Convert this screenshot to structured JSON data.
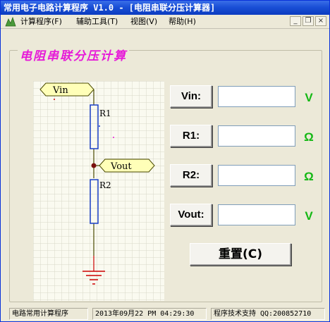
{
  "window": {
    "title": "常用电子电路计算程序  V1.0 - [电阻串联分压计算器]"
  },
  "menu": {
    "icon": "app-icon",
    "items": [
      "计算程序(F)",
      "辅助工具(T)",
      "视图(V)",
      "帮助(H)"
    ],
    "mdi_buttons": [
      "_",
      "❐",
      "×"
    ]
  },
  "calculator": {
    "title": "电阻串联分压计算",
    "schematic": {
      "vin_label": "Vin",
      "vout_label": "Vout",
      "r1_label": "R1",
      "r2_label": "R2"
    },
    "fields": [
      {
        "label": "Vin:",
        "value": "",
        "unit": "V",
        "unit_color": "#14b814"
      },
      {
        "label": "R1:",
        "value": "",
        "unit": "Ω",
        "unit_color": "#14b814"
      },
      {
        "label": "R2:",
        "value": "",
        "unit": "Ω",
        "unit_color": "#14b814"
      },
      {
        "label": "Vout:",
        "value": "",
        "unit": "V",
        "unit_color": "#14b814"
      }
    ],
    "reset_label": "重置(C)"
  },
  "status": {
    "app_name": "电路常用计算程序",
    "datetime": "2013年09月22 PM 04:29:30",
    "support": "程序技术支持 QQ:200852710"
  },
  "colors": {
    "title_color": "#e61ad8",
    "grid_bg": "#fafaf0",
    "grid_line": "#d8d8c8",
    "wire": "#4a4a00",
    "resistor": "#1a3fc8",
    "label_fill": "#ffffb8",
    "ground": "#cc0000"
  }
}
